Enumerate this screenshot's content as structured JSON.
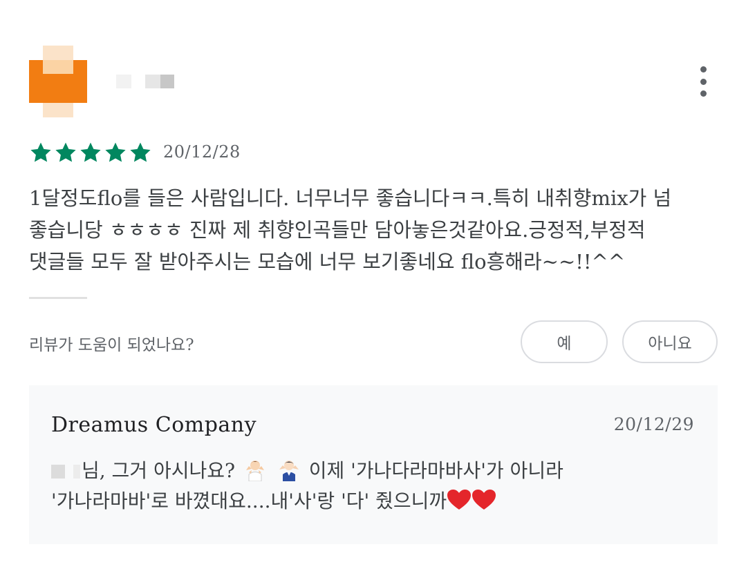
{
  "header": {
    "menu_icon": "more-vert-icon"
  },
  "rating": {
    "stars_filled": 5,
    "stars_total": 5,
    "star_color": "#01875f",
    "date": "20/12/28"
  },
  "review": {
    "line1": "1달정도flo를 들은 사람입니다. 너무너무 좋습니다ㅋㅋ.특히 내취향mix가 넘",
    "line2": "좋습니당 ㅎㅎㅎㅎ 진짜 제 취향인곡들만 담아놓은것같아요.긍정적,부정적",
    "line3": "댓글들 모두 잘 받아주시는 모습에 너무 보기좋네요 flo흥해라~~!!^^"
  },
  "helpful": {
    "question": "리뷰가 도움이 되었나요?",
    "yes_label": "예",
    "no_label": "아니요"
  },
  "reply": {
    "author": "Dreamus Company",
    "date": "20/12/29",
    "part1": "님, 그거 아시나요?",
    "part2": "이제 '가나다라마바사'가 아니라",
    "part3": "'가나라마바'로 바꼈대요....내'사'랑 '다' 줬으니까",
    "emoji_1": "person-shrugging-icon",
    "emoji_2": "man-shrugging-icon",
    "heart_icon": "red-heart-icon",
    "heart_color": "#e4262b"
  }
}
